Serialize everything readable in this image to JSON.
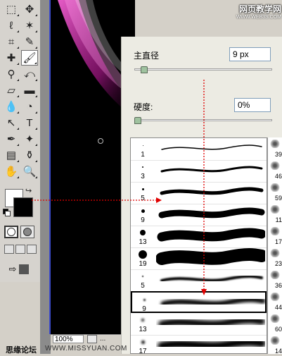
{
  "toolbox": {
    "tools": [
      {
        "name": "marquee-tool",
        "glyph": "⬚"
      },
      {
        "name": "move-tool",
        "glyph": "✥"
      },
      {
        "name": "lasso-tool",
        "glyph": "ℓ"
      },
      {
        "name": "magic-wand-tool",
        "glyph": "✶"
      },
      {
        "name": "crop-tool",
        "glyph": "⌗"
      },
      {
        "name": "slice-tool",
        "glyph": "✎"
      },
      {
        "name": "healing-brush-tool",
        "glyph": "✚"
      },
      {
        "name": "brush-tool",
        "glyph": "🖌"
      },
      {
        "name": "clone-stamp-tool",
        "glyph": "⚲"
      },
      {
        "name": "history-brush-tool",
        "glyph": "⤺"
      },
      {
        "name": "eraser-tool",
        "glyph": "▱"
      },
      {
        "name": "gradient-tool",
        "glyph": "▬"
      },
      {
        "name": "blur-tool",
        "glyph": "💧"
      },
      {
        "name": "dodge-tool",
        "glyph": "◔"
      },
      {
        "name": "path-selection-tool",
        "glyph": "↖"
      },
      {
        "name": "type-tool",
        "glyph": "T"
      },
      {
        "name": "pen-tool",
        "glyph": "✒"
      },
      {
        "name": "custom-shape-tool",
        "glyph": "✦"
      },
      {
        "name": "notes-tool",
        "glyph": "▤"
      },
      {
        "name": "eyedropper-tool",
        "glyph": "⚱"
      },
      {
        "name": "hand-tool",
        "glyph": "✋"
      },
      {
        "name": "zoom-tool",
        "glyph": "🔍"
      }
    ],
    "colors": {
      "foreground": "#ffffff",
      "background": "#000000"
    }
  },
  "status": {
    "zoom": "100%",
    "more": "..."
  },
  "panel": {
    "diameter_label": "主直径",
    "diameter_value": "9 px",
    "diameter_level": 0.05,
    "hardness_label": "硬度:",
    "hardness_value": "0%",
    "hardness_level": 0.0
  },
  "presets": [
    {
      "size": "1",
      "tip": 1,
      "stroke": 1.5,
      "blur": 0,
      "selected": false
    },
    {
      "size": "3",
      "tip": 2,
      "stroke": 3,
      "blur": 0,
      "selected": false
    },
    {
      "size": "5",
      "tip": 3,
      "stroke": 5,
      "blur": 0,
      "selected": false
    },
    {
      "size": "9",
      "tip": 5,
      "stroke": 9,
      "blur": 0,
      "selected": false
    },
    {
      "size": "13",
      "tip": 8,
      "stroke": 13,
      "blur": 0,
      "selected": false
    },
    {
      "size": "19",
      "tip": 12,
      "stroke": 18,
      "blur": 0,
      "selected": false
    },
    {
      "size": "5",
      "tip": 2,
      "stroke": 4,
      "blur": 1,
      "selected": false
    },
    {
      "size": "9",
      "tip": 3,
      "stroke": 7,
      "blur": 2,
      "selected": true
    },
    {
      "size": "13",
      "tip": 4,
      "stroke": 10,
      "blur": 3,
      "selected": false
    },
    {
      "size": "17",
      "tip": 5,
      "stroke": 12,
      "blur": 3,
      "selected": false
    }
  ],
  "scroll_numbers": [
    "39",
    "46",
    "59",
    "11",
    "17",
    "23",
    "36",
    "44",
    "60",
    "14"
  ],
  "watermarks": {
    "top_right": "网页教学网",
    "top_right_url": "WWW.WEB3S.COM",
    "bottom_left": "思缘论坛",
    "bottom_url": "WWW.MISSYUAN.COM"
  }
}
